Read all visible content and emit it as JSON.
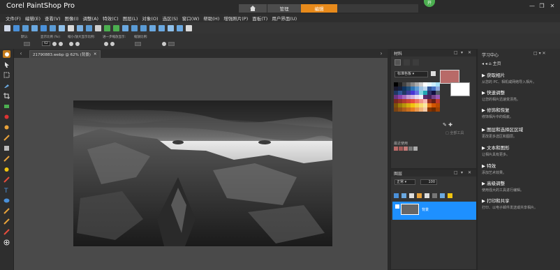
{
  "app": {
    "logo": "Corel PaintShop Pro",
    "workspace_tabs": [
      "管理",
      "编辑"
    ],
    "avatar_text": "开"
  },
  "menu": [
    "文件(F)",
    "编辑(E)",
    "查看(V)",
    "图像(I)",
    "调整(A)",
    "特效(C)",
    "图层(L)",
    "对象(O)",
    "选区(S)",
    "窗口(W)",
    "帮助(H)",
    "增强照片(P)",
    "面板(T)",
    "用户界面(U)"
  ],
  "options": {
    "label_1": "默认:",
    "label_2": "显示比例 (%):",
    "label_3": "缩小/放大显示比例:",
    "label_4": "进一步缩放显示:",
    "label_5": "缩放比例:",
    "zoom_value": "62"
  },
  "document": {
    "tab_title": "21790883.webp @ 62% (背景)"
  },
  "materials": {
    "title": "材料",
    "mode_select": "标准色板",
    "recent_label": "最近使用",
    "transparent_label": "全部工具",
    "colors": {
      "foreground": "#b86a68",
      "background": "#ffffff"
    }
  },
  "layers": {
    "title": "图层",
    "blend_mode": "正常",
    "opacity": "100",
    "layer_name": "背景"
  },
  "learning": {
    "title": "学习中心",
    "home": "主页",
    "items": [
      {
        "title": "▶ 获取相片",
        "desc": "从您的 PC、相机或网络导入相片。"
      },
      {
        "title": "▶ 快速调整",
        "desc": "让您的相片迅速变漂亮。"
      },
      {
        "title": "▶ 修饰和恢复",
        "desc": "修饰相片中的瑕疵。"
      },
      {
        "title": "▶ 图层和选择区区域",
        "desc": "更改更多选区和图层。"
      },
      {
        "title": "▶ 文本和图形",
        "desc": "让相片具有更多。"
      },
      {
        "title": "▶ 特效",
        "desc": "添加艺术效果。"
      },
      {
        "title": "▶ 高级调整",
        "desc": "使用强大的工具进行编辑。"
      },
      {
        "title": "▶ 打印和共享",
        "desc": "打印、以电子邮件发送或共享相片。"
      }
    ]
  }
}
